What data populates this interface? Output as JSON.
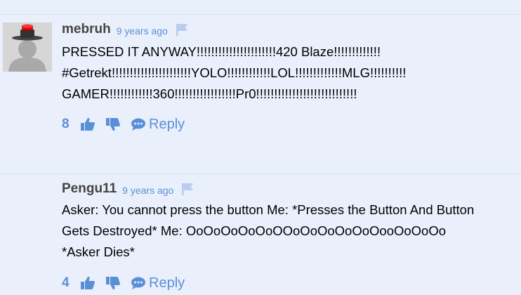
{
  "comments": [
    {
      "username": "mebruh",
      "timestamp": "9 years ago",
      "lines": [
        "PRESSED IT ANYWAY!!!!!!!!!!!!!!!!!!!!!!420 Blaze!!!!!!!!!!!!!",
        "#Getrekt!!!!!!!!!!!!!!!!!!!!!!YOLO!!!!!!!!!!!!LOL!!!!!!!!!!!!!MLG!!!!!!!!!!",
        "GAMER!!!!!!!!!!!!360!!!!!!!!!!!!!!!!!Pr0!!!!!!!!!!!!!!!!!!!!!!!!!!!!"
      ],
      "votes": "8",
      "reply_label": "Reply",
      "has_avatar": true
    },
    {
      "username": "Pengu11",
      "timestamp": "9 years ago",
      "lines": [
        "Asker: You cannot press the button Me: *Presses the Button And Button",
        "Gets Destroyed* Me: OoOoOoOoOoOOoOoOoOoOoOooOoOoOo",
        "*Asker Dies*"
      ],
      "votes": "4",
      "reply_label": "Reply",
      "has_avatar": false
    }
  ],
  "colors": {
    "background": "#e9f0fb",
    "accent": "#5a8fd8",
    "flag": "#b9cdee",
    "username": "#444444"
  },
  "icons": [
    "flag-icon",
    "thumbs-up-icon",
    "thumbs-down-icon",
    "comment-bubble-icon",
    "avatar-hat-icon"
  ]
}
